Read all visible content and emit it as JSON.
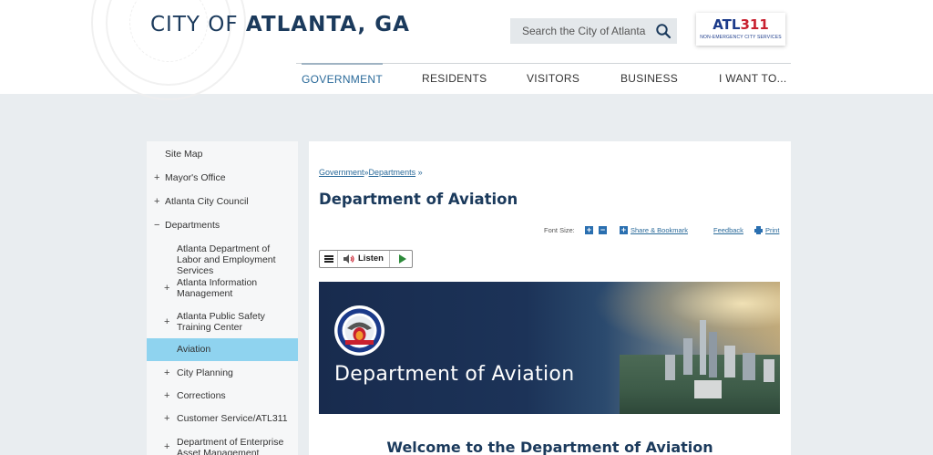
{
  "header": {
    "title_thin": "CITY OF ",
    "title_bold": "ATLANTA, GA",
    "search_placeholder": "Search the City of Atlanta",
    "search_icon": "search-icon",
    "atl311": {
      "atl": "ATL",
      "num": "311",
      "sub": "NON-EMERGENCY CITY SERVICES"
    }
  },
  "nav": {
    "items": [
      {
        "label": "GOVERNMENT",
        "active": true
      },
      {
        "label": "RESIDENTS"
      },
      {
        "label": "VISITORS"
      },
      {
        "label": "BUSINESS"
      },
      {
        "label": "I WANT TO..."
      }
    ]
  },
  "sidebar": {
    "items": [
      {
        "label": "Site Map",
        "prefix": ""
      },
      {
        "label": "Mayor's Office",
        "prefix": "+"
      },
      {
        "label": "Atlanta City Council",
        "prefix": "+"
      },
      {
        "label": "Departments",
        "prefix": "−"
      },
      {
        "label": "Atlanta Department of Labor and Employment Services",
        "prefix": ""
      },
      {
        "label": "Atlanta Information Management",
        "prefix": "+"
      },
      {
        "label": "Atlanta Public Safety Training Center",
        "prefix": "+"
      },
      {
        "label": "Aviation",
        "prefix": "",
        "active": true
      },
      {
        "label": "City Planning",
        "prefix": "+"
      },
      {
        "label": "Corrections",
        "prefix": "+"
      },
      {
        "label": "Customer Service/ATL311",
        "prefix": "+"
      },
      {
        "label": "Department of Enterprise Asset Management",
        "prefix": "+"
      }
    ]
  },
  "main": {
    "breadcrumb": {
      "item1": "Government",
      "sep1": "»",
      "item2": "Departments",
      "sep2": " »"
    },
    "page_title": "Department of Aviation",
    "tools": {
      "font_size_label": "Font Size:",
      "increase": "+",
      "decrease": "−",
      "share_icon": "+",
      "share_label": "Share & Bookmark",
      "feedback_label": "Feedback",
      "print_label": "Print"
    },
    "listen": {
      "label": "Listen"
    },
    "banner": {
      "title": "Department of Aviation"
    },
    "welcome": "Welcome to the Department of Aviation"
  },
  "colors": {
    "title_navy": "#1b3a5c",
    "link_blue": "#2a6a9a",
    "sidebar_active": "#8fd3ef",
    "atl311_red": "#c8202f"
  }
}
